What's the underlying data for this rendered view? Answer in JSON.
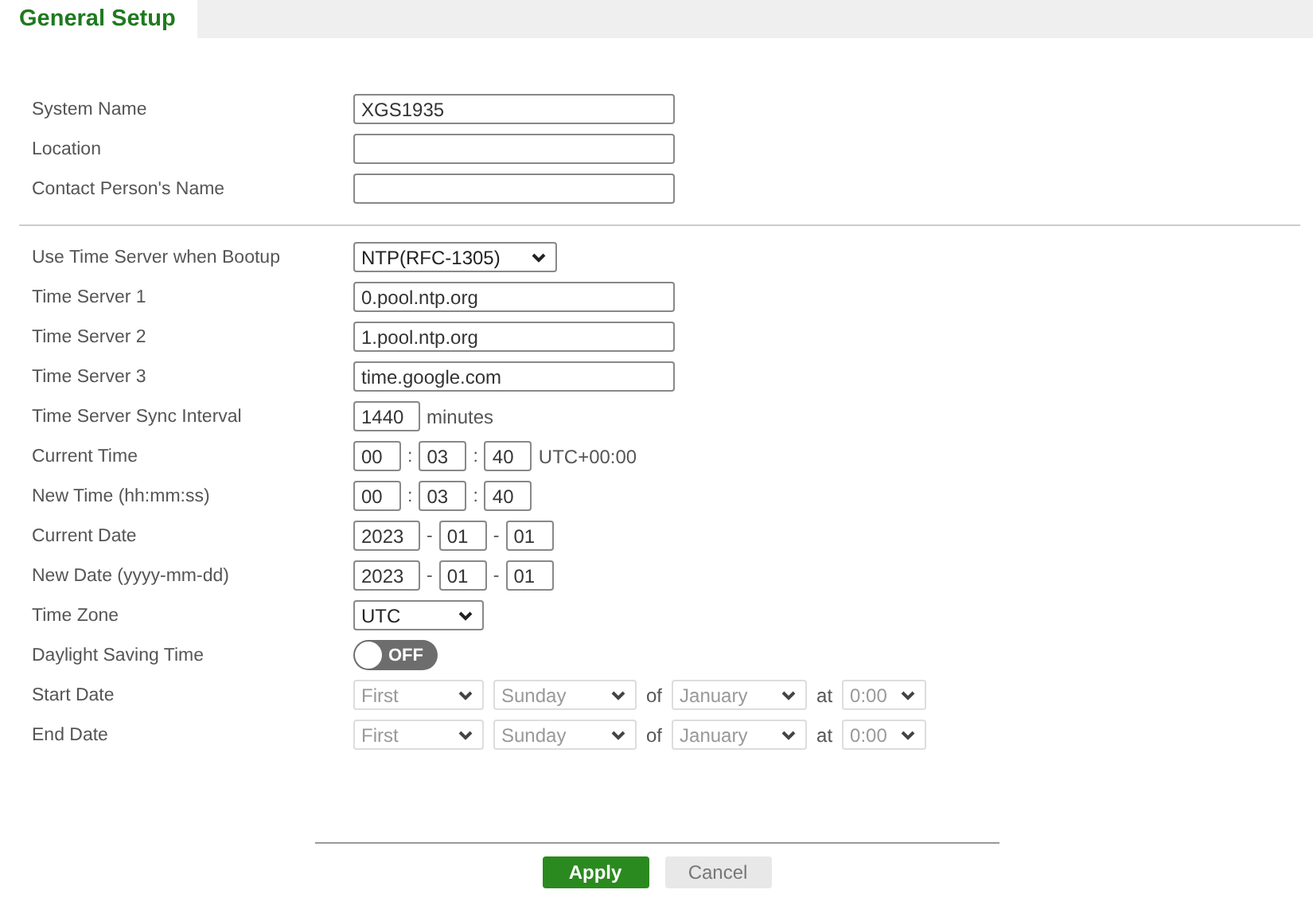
{
  "tab": {
    "label": "General Setup",
    "selected": true
  },
  "sections": [
    {
      "rows": [
        {
          "kind": "text",
          "label": "System Name",
          "value": "XGS1935"
        },
        {
          "kind": "text",
          "label": "Location"
        },
        {
          "kind": "text",
          "label": "Contact Person's Name"
        }
      ]
    },
    {
      "rows": [
        {
          "kind": "select",
          "label": "Use Time Server when Bootup",
          "value": "NTP(RFC-1305)"
        },
        {
          "kind": "text",
          "label": "Time Server 1",
          "value": "0.pool.ntp.org"
        },
        {
          "kind": "text",
          "label": "Time Server 2",
          "value": "1.pool.ntp.org"
        },
        {
          "kind": "text",
          "label": "Time Server 3",
          "value": "time.google.com"
        },
        {
          "kind": "interval",
          "label": "Time Server Sync Interval",
          "value": "1440",
          "unit": "minutes"
        },
        {
          "kind": "time",
          "label": "Current Time",
          "parts": [
            "00",
            "03",
            "40"
          ],
          "separator": ":",
          "suffix": "UTC+00:00"
        },
        {
          "kind": "time",
          "label": "New Time (hh:mm:ss)",
          "parts": [
            "00",
            "03",
            "40"
          ],
          "separator": ":"
        },
        {
          "kind": "date",
          "label": "Current Date",
          "parts": [
            "2023",
            "01",
            "01"
          ],
          "separator": "-"
        },
        {
          "kind": "date",
          "label": "New Date (yyyy-mm-dd)",
          "parts": [
            "2023",
            "01",
            "01"
          ],
          "separator": "-"
        },
        {
          "kind": "select",
          "label": "Time Zone",
          "value": "UTC"
        },
        {
          "kind": "toggle",
          "label": "Daylight Saving Time",
          "on": false,
          "state_text": "OFF"
        },
        {
          "kind": "schedule",
          "label": "Start Date",
          "disabled": true,
          "fields": [
            {
              "kind": "select",
              "value": "First"
            },
            {
              "kind": "select",
              "value": "Sunday"
            },
            {
              "kind": "word",
              "value": "of"
            },
            {
              "kind": "select",
              "value": "January"
            },
            {
              "kind": "word",
              "value": "at"
            },
            {
              "kind": "select",
              "value": "0:00"
            }
          ]
        },
        {
          "kind": "schedule",
          "label": "End Date",
          "disabled": true,
          "fields": [
            {
              "kind": "select",
              "value": "First"
            },
            {
              "kind": "select",
              "value": "Sunday"
            },
            {
              "kind": "word",
              "value": "of"
            },
            {
              "kind": "select",
              "value": "January"
            },
            {
              "kind": "word",
              "value": "at"
            },
            {
              "kind": "select",
              "value": "0:00"
            }
          ]
        }
      ]
    }
  ],
  "buttons": [
    {
      "kind": "primary",
      "label": "Apply"
    },
    {
      "kind": "secondary",
      "label": "Cancel"
    }
  ]
}
